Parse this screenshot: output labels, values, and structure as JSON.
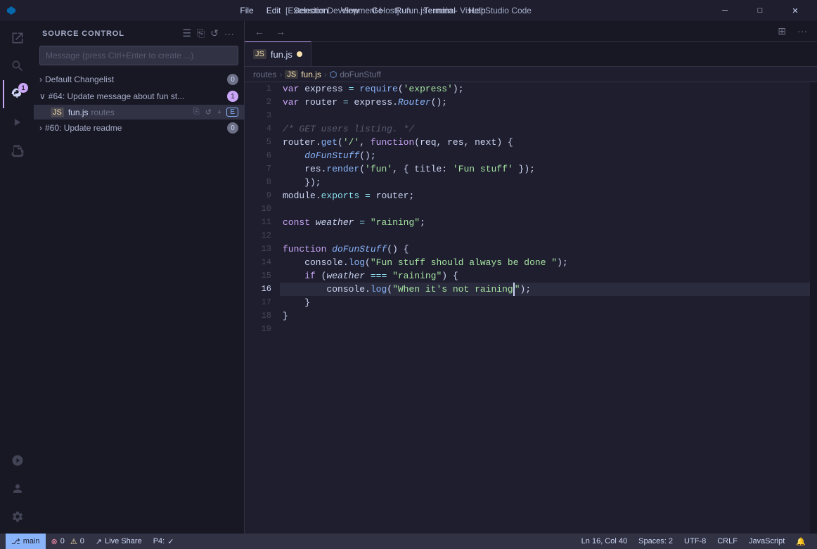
{
  "titlebar": {
    "title": "[Extension Development Host] - fun.js - main - Visual Studio Code",
    "menu": [
      "File",
      "Edit",
      "Selection",
      "View",
      "Go",
      "Run",
      "Terminal",
      "Help"
    ],
    "controls": [
      "─",
      "□",
      "✕"
    ]
  },
  "activity": {
    "icons": [
      {
        "name": "explorer-icon",
        "symbol": "⎇",
        "badge": null,
        "active": false
      },
      {
        "name": "search-icon",
        "symbol": "🔍",
        "badge": null,
        "active": false
      },
      {
        "name": "source-control-icon",
        "symbol": "⎇",
        "badge": "1",
        "active": true
      },
      {
        "name": "run-icon",
        "symbol": "▷",
        "badge": null,
        "active": false
      },
      {
        "name": "extensions-icon",
        "symbol": "⧉",
        "badge": null,
        "active": false
      }
    ],
    "bottom_icons": [
      {
        "name": "remote-icon",
        "symbol": "⊞",
        "badge": null
      },
      {
        "name": "accounts-icon",
        "symbol": "👤",
        "badge": null
      },
      {
        "name": "settings-icon",
        "symbol": "⚙",
        "badge": null
      }
    ]
  },
  "sidebar": {
    "title": "SOURCE CONTROL",
    "header_actions": [
      "☰",
      "⎘",
      "↺",
      "···"
    ],
    "commit_placeholder": "Message (press Ctrl+Enter to create ...)",
    "changelists": [
      {
        "name": "Default Changelist",
        "collapsed": true,
        "badge": "0",
        "badge_type": "normal"
      },
      {
        "name": "#64: Update message about fun st...",
        "collapsed": false,
        "badge": "1",
        "badge_type": "purple",
        "files": [
          {
            "icon": "JS",
            "name": "fun.js",
            "path": "routes",
            "actions": [
              "⎘",
              "↺",
              "↺",
              "–",
              "+"
            ],
            "badge": "E"
          }
        ]
      },
      {
        "name": "#60: Update readme",
        "collapsed": true,
        "badge": "0",
        "badge_type": "normal"
      }
    ]
  },
  "editor": {
    "tab": {
      "label": "fun.js",
      "modified": true,
      "icon": "JS"
    },
    "breadcrumb": [
      "routes",
      "fun.js",
      "doFunStuff"
    ],
    "nav_buttons": [
      "←",
      "→",
      "⊞",
      "···"
    ],
    "lines": [
      {
        "num": 1,
        "tokens": [
          {
            "t": "kw",
            "v": "var"
          },
          {
            "t": "var",
            "v": " express "
          },
          {
            "t": "op",
            "v": "="
          },
          {
            "t": "var",
            "v": " "
          },
          {
            "t": "fn",
            "v": "require"
          },
          {
            "t": "punc",
            "v": "("
          },
          {
            "t": "str",
            "v": "'express'"
          },
          {
            "t": "punc",
            "v": ")"
          },
          {
            "t": "punc",
            "v": ";"
          }
        ]
      },
      {
        "num": 2,
        "tokens": [
          {
            "t": "kw",
            "v": "var"
          },
          {
            "t": "var",
            "v": " router "
          },
          {
            "t": "op",
            "v": "="
          },
          {
            "t": "var",
            "v": " express"
          },
          {
            "t": "punc",
            "v": "."
          },
          {
            "t": "italic fn",
            "v": "Router"
          },
          {
            "t": "punc",
            "v": "();"
          }
        ]
      },
      {
        "num": 3,
        "tokens": []
      },
      {
        "num": 4,
        "tokens": [
          {
            "t": "cmt",
            "v": "/* GET users listing. */"
          }
        ]
      },
      {
        "num": 5,
        "tokens": [
          {
            "t": "var",
            "v": "router"
          },
          {
            "t": "punc",
            "v": "."
          },
          {
            "t": "method",
            "v": "get"
          },
          {
            "t": "punc",
            "v": "("
          },
          {
            "t": "str",
            "v": "'/'"
          },
          {
            "t": "punc",
            "v": ", "
          },
          {
            "t": "kw",
            "v": "function"
          },
          {
            "t": "punc",
            "v": "("
          },
          {
            "t": "var",
            "v": "req, res, next"
          },
          {
            "t": "punc",
            "v": ") {"
          }
        ]
      },
      {
        "num": 6,
        "tokens": [
          {
            "t": "var",
            "v": "    "
          },
          {
            "t": "italic fn",
            "v": "doFunStuff"
          },
          {
            "t": "punc",
            "v": "();"
          }
        ]
      },
      {
        "num": 7,
        "tokens": [
          {
            "t": "var",
            "v": "    res"
          },
          {
            "t": "punc",
            "v": "."
          },
          {
            "t": "method",
            "v": "render"
          },
          {
            "t": "punc",
            "v": "("
          },
          {
            "t": "str",
            "v": "'fun'"
          },
          {
            "t": "punc",
            "v": ", { title: "
          },
          {
            "t": "str",
            "v": "'Fun stuff'"
          },
          {
            "t": "punc",
            "v": " });"
          }
        ]
      },
      {
        "num": 8,
        "tokens": [
          {
            "t": "punc",
            "v": "    });"
          }
        ]
      },
      {
        "num": 9,
        "tokens": [
          {
            "t": "var",
            "v": "module"
          },
          {
            "t": "punc",
            "v": "."
          },
          {
            "t": "prop",
            "v": "exports"
          },
          {
            "t": "var",
            "v": " "
          },
          {
            "t": "op",
            "v": "="
          },
          {
            "t": "var",
            "v": " router;"
          }
        ]
      },
      {
        "num": 10,
        "tokens": []
      },
      {
        "num": 11,
        "tokens": [
          {
            "t": "kw",
            "v": "const"
          },
          {
            "t": "var",
            "v": " "
          },
          {
            "t": "italic var",
            "v": "weather"
          },
          {
            "t": "var",
            "v": " "
          },
          {
            "t": "op",
            "v": "="
          },
          {
            "t": "var",
            "v": " "
          },
          {
            "t": "str",
            "v": "\"raining\""
          },
          {
            "t": "punc",
            "v": ";"
          }
        ]
      },
      {
        "num": 12,
        "tokens": []
      },
      {
        "num": 13,
        "tokens": [
          {
            "t": "kw",
            "v": "function"
          },
          {
            "t": "var",
            "v": " "
          },
          {
            "t": "italic fn",
            "v": "doFunStuff"
          },
          {
            "t": "punc",
            "v": "() {"
          }
        ]
      },
      {
        "num": 14,
        "tokens": [
          {
            "t": "var",
            "v": "    console"
          },
          {
            "t": "punc",
            "v": "."
          },
          {
            "t": "method",
            "v": "log"
          },
          {
            "t": "punc",
            "v": "("
          },
          {
            "t": "str",
            "v": "\"Fun stuff should always be done \""
          },
          {
            "t": "punc",
            "v": ");"
          }
        ]
      },
      {
        "num": 15,
        "tokens": [
          {
            "t": "var",
            "v": "    "
          },
          {
            "t": "kw",
            "v": "if"
          },
          {
            "t": "var",
            "v": " ("
          },
          {
            "t": "italic var",
            "v": "weather"
          },
          {
            "t": "var",
            "v": " "
          },
          {
            "t": "op",
            "v": "==="
          },
          {
            "t": "var",
            "v": " "
          },
          {
            "t": "str",
            "v": "\"raining\""
          },
          {
            "t": "punc",
            "v": ") {"
          }
        ]
      },
      {
        "num": 16,
        "tokens": [
          {
            "t": "var",
            "v": "        console"
          },
          {
            "t": "punc",
            "v": "."
          },
          {
            "t": "method",
            "v": "log"
          },
          {
            "t": "punc",
            "v": "("
          },
          {
            "t": "str",
            "v": "\"When it's not raining"
          },
          {
            "t": "punc",
            "v": "|\"}),;"
          }
        ],
        "current": true
      },
      {
        "num": 17,
        "tokens": [
          {
            "t": "punc",
            "v": "    }"
          }
        ]
      },
      {
        "num": 18,
        "tokens": [
          {
            "t": "punc",
            "v": "}"
          }
        ]
      },
      {
        "num": 19,
        "tokens": []
      }
    ]
  },
  "statusbar": {
    "left": [
      {
        "label": "⎇ main",
        "type": "blue"
      },
      {
        "label": "⊗ 0  ⚠ 0",
        "type": "normal"
      },
      {
        "label": "↗ Live Share",
        "type": "normal"
      },
      {
        "label": "P4: ✓",
        "type": "normal"
      }
    ],
    "right": [
      {
        "label": "Ln 16, Col 40"
      },
      {
        "label": "Spaces: 2"
      },
      {
        "label": "UTF-8"
      },
      {
        "label": "CRLF"
      },
      {
        "label": "JavaScript"
      },
      {
        "label": "⊞"
      }
    ]
  }
}
